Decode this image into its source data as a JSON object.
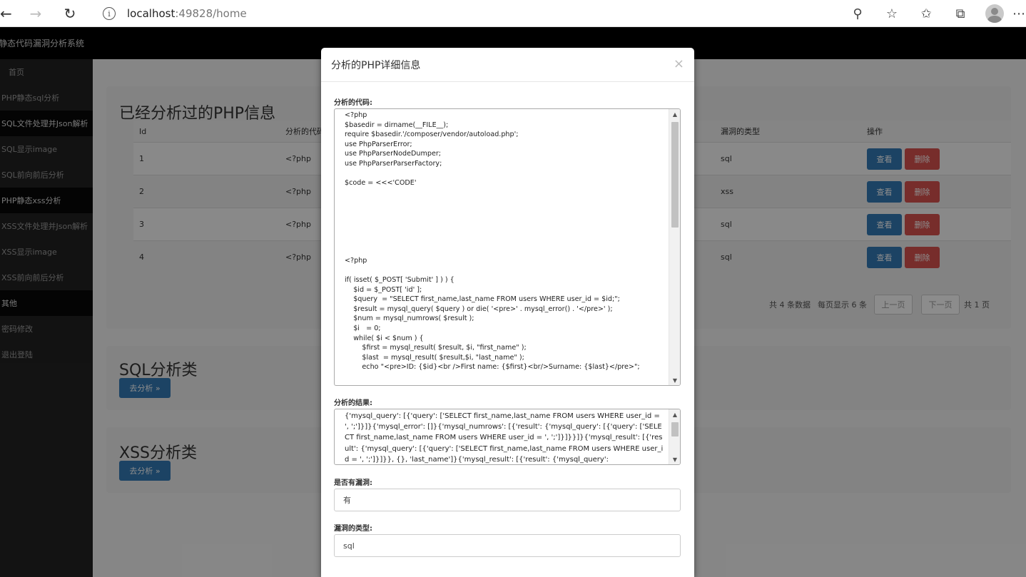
{
  "browser": {
    "url_host": "localhost",
    "url_rest": ":49828/home"
  },
  "app": {
    "brand": "静态代码漏洞分析系统"
  },
  "sidebar": {
    "items": [
      {
        "label": "首页"
      },
      {
        "label": "PHP静态sql分析"
      },
      {
        "label": "SQL文件处理并Json解析"
      },
      {
        "label": "SQL显示image"
      },
      {
        "label": "SQL前向前后分析"
      },
      {
        "label": "PHP静态xss分析"
      },
      {
        "label": "XSS文件处理并Json解析"
      },
      {
        "label": "XSS显示image"
      },
      {
        "label": "XSS前向前后分析"
      },
      {
        "label": "其他"
      },
      {
        "label": "密码修改"
      },
      {
        "label": "退出登陆"
      }
    ]
  },
  "analyzed": {
    "title": "已经分析过的PHP信息",
    "columns": [
      "Id",
      "分析的代码",
      "漏洞的类型",
      "操作"
    ],
    "rows": [
      {
        "id": "1",
        "code": "<?php",
        "type": "sql"
      },
      {
        "id": "2",
        "code": "<?php",
        "type": "xss"
      },
      {
        "id": "3",
        "code": "<?php",
        "type": "sql"
      },
      {
        "id": "4",
        "code": "<?php",
        "type": "sql"
      }
    ],
    "view_label": "查看",
    "delete_label": "删除",
    "pager": {
      "total": "共 4 条数据",
      "per_page": "每页显示 6 条",
      "prev": "上一页",
      "next": "下一页",
      "pages": "共 1 页"
    }
  },
  "sql_panel": {
    "title": "SQL分析类",
    "button": "去分析 »"
  },
  "xss_panel": {
    "title": "XSS分析类",
    "button": "去分析 »"
  },
  "modal": {
    "title": "分析的PHP详细信息",
    "close": "×",
    "code_label": "分析的代码:",
    "code": "<?php\n$basedir = dirname(__FILE__);\nrequire $basedir.'/composer/vendor/autoload.php';\nuse PhpParserError;\nuse PhpParserNodeDumper;\nuse PhpParserParserFactory;\n\n$code = <<<'CODE'\n\n\n\n\n\n\n\n<?php\n\nif( isset( $_POST[ 'Submit' ] ) ) {\n    $id = $_POST[ 'id' ];\n    $query  = \"SELECT first_name,last_name FROM users WHERE user_id = $id;\";\n    $result = mysql_query( $query ) or die( '<pre>' . mysql_error() . '</pre>' );\n    $num = mysql_numrows( $result );\n    $i   = 0;\n    while( $i < $num ) {\n        $first = mysql_result( $result, $i, \"first_name\" );\n        $last  = mysql_result( $result,$i, \"last_name\" );\n        echo \"<pre>ID: {$id}<br />First name: {$first}<br/>Surname: {$last}</pre>\";",
    "result_label": "分析的结果:",
    "result": "{'mysql_query': [{'query': ['SELECT first_name,last_name FROM users WHERE user_id = ', ';']}]}{'mysql_error': []}{'mysql_numrows': [{'result': {'mysql_query': [{'query': ['SELECT first_name,last_name FROM users WHERE user_id = ', ';']}]}}]}{'mysql_result': [{'result': {'mysql_query': [{'query': ['SELECT first_name,last_name FROM users WHERE user_id = ', ';']}]}}, {}, 'last_name']}{'mysql_result': [{'result': {'mysql_query':",
    "vuln_label": "是否有漏洞:",
    "vuln_value": "有",
    "type_label": "漏洞的类型:",
    "type_value": "sql"
  }
}
